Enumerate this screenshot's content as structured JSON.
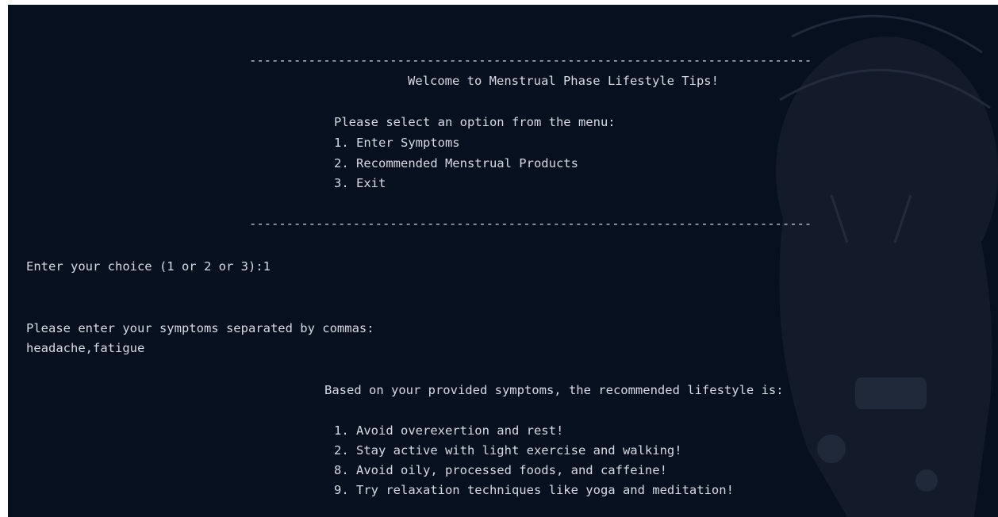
{
  "banner": {
    "top_rule": "----------------------------------------------------------------------------",
    "title": "Welcome to Menstrual Phase Lifestyle Tips!",
    "menu_prompt": "Please select an option from the menu:",
    "options": [
      "1. Enter Symptoms",
      "2. Recommended Menstrual Products",
      "3. Exit"
    ],
    "bottom_rule": "----------------------------------------------------------------------------"
  },
  "session": {
    "choice_prompt": "Enter your choice (1 or 2 or 3):1",
    "symptoms_prompt": "Please enter your symptoms separated by commas:",
    "symptoms_input": "headache,fatigue",
    "result_header": "Based on your provided symptoms, the recommended lifestyle is:",
    "recommendations": [
      "1. Avoid overexertion and rest!",
      "2. Stay active with light exercise and walking!",
      "8. Avoid oily, processed foods, and caffeine!",
      "9. Try relaxation techniques like yoga and meditation!"
    ]
  },
  "colors": {
    "background": "#07101f",
    "text": "#d6dbe4"
  }
}
